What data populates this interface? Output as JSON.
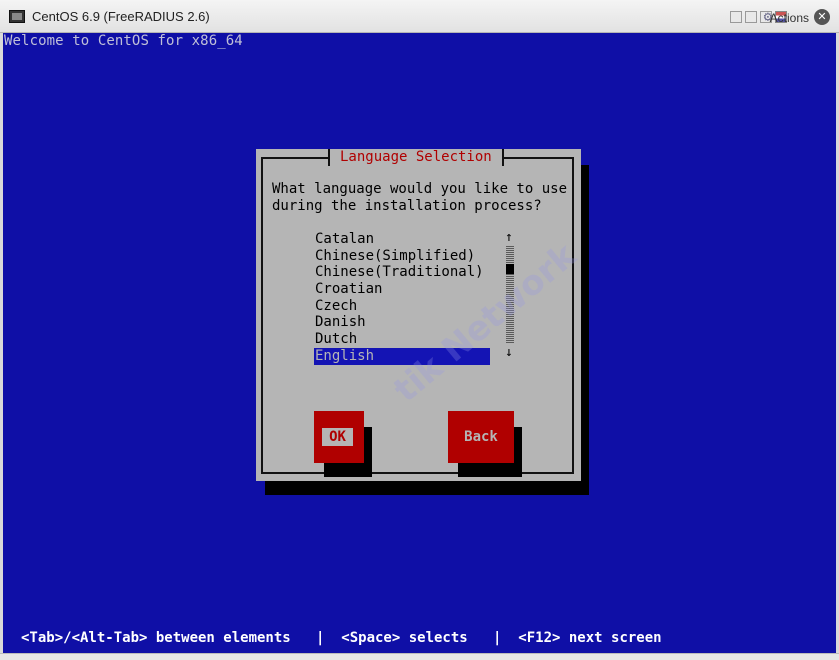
{
  "window": {
    "title": "CentOS 6.9 (FreeRADIUS 2.6)",
    "actions_label": "Actions",
    "close_glyph": "✕",
    "gear_glyph": "⚙"
  },
  "console": {
    "welcome": "Welcome to CentOS for x86_64",
    "footer": "<Tab>/<Alt-Tab> between elements   |  <Space> selects   |  <F12> next screen"
  },
  "dialog": {
    "title": "Language Selection",
    "prompt_line1": "What language would you like to use",
    "prompt_line2": "during the installation process?",
    "languages": [
      "Catalan",
      "Chinese(Simplified)",
      "Chinese(Traditional)",
      "Croatian",
      "Czech",
      "Danish",
      "Dutch",
      "English"
    ],
    "selected_index": 7,
    "ok_label": "OK",
    "back_label": "Back",
    "scroll_up_glyph": "↑",
    "scroll_down_glyph": "↓"
  },
  "colors": {
    "console_bg": "#0f0fa6",
    "dialog_bg": "#b5b5b5",
    "button_red": "#b00000",
    "selection_blue": "#1414b4"
  },
  "watermark": "tik Network"
}
